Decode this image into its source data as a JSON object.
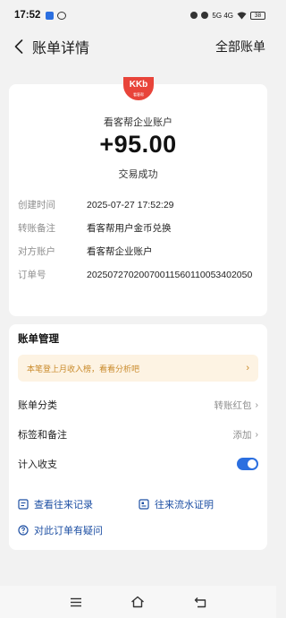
{
  "status_bar": {
    "time": "17:52",
    "network": "5G 4G",
    "battery": "38"
  },
  "nav": {
    "title": "账单详情",
    "right_link": "全部账单"
  },
  "header": {
    "logo_text": "KKb",
    "logo_subtext": "看客帮",
    "account_name": "看客帮企业账户",
    "amount": "+95.00",
    "status": "交易成功"
  },
  "details": [
    {
      "label": "创建时间",
      "value": "2025-07-27 17:52:29"
    },
    {
      "label": "转账备注",
      "value": "看客帮用户金币兑换"
    },
    {
      "label": "对方账户",
      "value": "看客帮企业账户"
    },
    {
      "label": "订单号",
      "value": "20250727020070011560110053402050"
    }
  ],
  "management": {
    "title": "账单管理",
    "banner": "本笔登上月收入榜，看看分析吧",
    "category_label": "账单分类",
    "category_value": "转账红包",
    "tags_label": "标签和备注",
    "tags_value": "添加",
    "count_label": "计入收支",
    "count_enabled": true
  },
  "links": {
    "history": "查看往来记录",
    "certificate": "往来流水证明",
    "question": "对此订单有疑问"
  },
  "colors": {
    "accent": "#2b6fe0",
    "link": "#1d4fa3",
    "banner_text": "#c98a2a",
    "logo": "#e8443a"
  }
}
